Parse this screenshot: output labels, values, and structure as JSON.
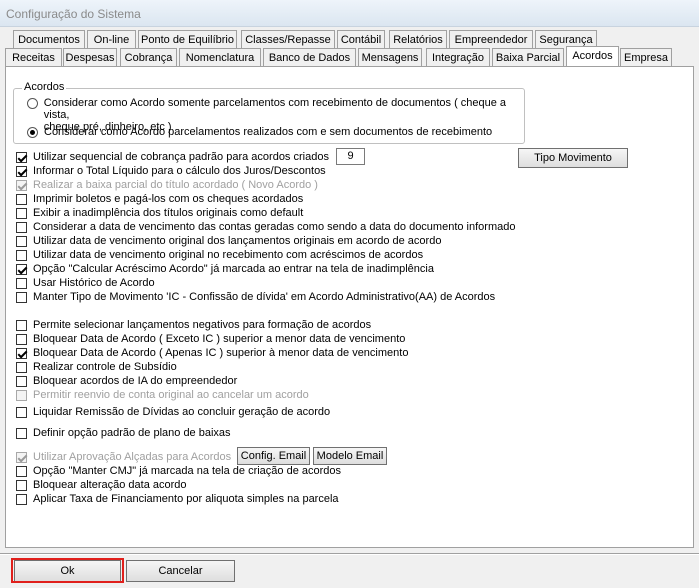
{
  "window": {
    "title": "Configuração do Sistema"
  },
  "tabs_row1": [
    "Documentos",
    "On-line",
    "Ponto de Equilíbrio",
    "Classes/Repasse",
    "Contábil",
    "Relatórios",
    "Empreendedor",
    "Segurança"
  ],
  "tabs_row2": [
    "Receitas",
    "Despesas",
    "Cobrança",
    "Nomenclatura",
    "Banco de Dados",
    "Mensagens",
    "Integração",
    "Baixa Parcial",
    "Acordos",
    "Empresa"
  ],
  "active_tab": "Acordos",
  "acordos_group": {
    "legend": "Acordos",
    "options": [
      {
        "line1": "Considerar como Acordo somente parcelamentos com recebimento de documentos ( cheque a vista,",
        "line2": "cheque pré, dinheiro, etc )",
        "selected": false
      },
      {
        "line1": "Considerar como Acordo parcelamentos realizados com e sem documentos de recebimento",
        "line2": "",
        "selected": true
      }
    ]
  },
  "sequencial_value": "9",
  "buttons": {
    "tipo_movimento": "Tipo Movimento",
    "config_email": "Config. Email",
    "modelo_email": "Modelo Email",
    "ok": "Ok",
    "cancelar": "Cancelar"
  },
  "checkboxes": [
    {
      "label": "Utilizar sequencial de cobrança padrão para acordos criados",
      "checked": true,
      "disabled": false
    },
    {
      "label": "Informar o Total Líquido para o cálculo dos Juros/Descontos",
      "checked": true,
      "disabled": false
    },
    {
      "label": "Realizar a baixa parcial do título acordado ( Novo Acordo )",
      "checked": true,
      "disabled": true
    },
    {
      "label": "Imprimir boletos e pagá-los com os cheques acordados",
      "checked": false,
      "disabled": false
    },
    {
      "label": "Exibir a inadimplência dos títulos originais como default",
      "checked": false,
      "disabled": false
    },
    {
      "label": "Considerar a data de vencimento das contas geradas como sendo a data do documento informado",
      "checked": false,
      "disabled": false
    },
    {
      "label": "Utilizar data de vencimento original dos lançamentos originais em acordo de acordo",
      "checked": false,
      "disabled": false
    },
    {
      "label": "Utilizar data de vencimento original no recebimento com acréscimos de acordos",
      "checked": false,
      "disabled": false
    },
    {
      "label": "Opção \"Calcular Acréscimo Acordo\" já marcada ao entrar na tela de inadimplência",
      "checked": true,
      "disabled": false
    },
    {
      "label": "Usar Histórico de Acordo",
      "checked": false,
      "disabled": false
    },
    {
      "label": "Manter Tipo de Movimento 'IC - Confissão de dívida' em Acordo Administrativo(AA) de Acordos",
      "checked": false,
      "disabled": false
    },
    {
      "label": "Permite selecionar lançamentos negativos para formação de acordos",
      "checked": false,
      "disabled": false
    },
    {
      "label": "Bloquear Data de Acordo ( Exceto IC ) superior a menor data de vencimento",
      "checked": false,
      "disabled": false
    },
    {
      "label": "Bloquear Data de Acordo ( Apenas IC ) superior à menor data de vencimento",
      "checked": true,
      "disabled": false
    },
    {
      "label": "Realizar controle de Subsídio",
      "checked": false,
      "disabled": false
    },
    {
      "label": "Bloquear acordos de IA do empreendedor",
      "checked": false,
      "disabled": false
    },
    {
      "label": "Permitir reenvio de conta original ao cancelar um acordo",
      "checked": false,
      "disabled": true
    },
    {
      "label": "Liquidar Remissão de Dívidas ao concluir geração de acordo",
      "checked": false,
      "disabled": false
    },
    {
      "label": "Definir opção padrão de plano de baixas",
      "checked": false,
      "disabled": false
    },
    {
      "label": "Utilizar Aprovação Alçadas para Acordos",
      "checked": true,
      "disabled": true
    },
    {
      "label": "Opção \"Manter CMJ\" já marcada na tela de criação de acordos",
      "checked": false,
      "disabled": false
    },
    {
      "label": "Bloquear alteração data acordo",
      "checked": false,
      "disabled": false
    },
    {
      "label": "Aplicar Taxa de Financiamento por aliquota simples na parcela",
      "checked": false,
      "disabled": false
    }
  ]
}
